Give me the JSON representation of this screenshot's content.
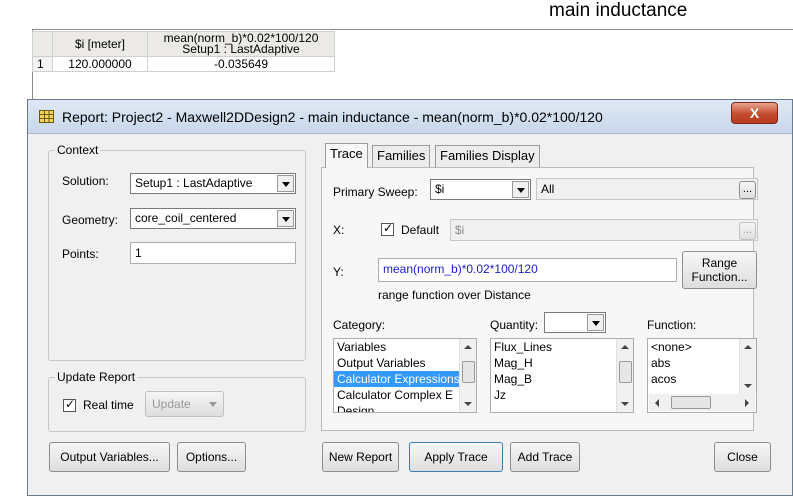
{
  "background": {
    "title": "main inductance",
    "table": {
      "headers": [
        "$i [meter]",
        "mean(norm_b)*0.02*100/120",
        "Setup1 : LastAdaptive"
      ],
      "rows": [
        [
          "1",
          "120.000000",
          "-0.035649"
        ]
      ]
    }
  },
  "dialog": {
    "title": "Report: Project2 - Maxwell2DDesign2 - main inductance - mean(norm_b)*0.02*100/120",
    "close_label": "X",
    "context": {
      "legend": "Context",
      "solution_label": "Solution:",
      "solution_value": "Setup1 : LastAdaptive",
      "geometry_label": "Geometry:",
      "geometry_value": "core_coil_centered",
      "points_label": "Points:",
      "points_value": "1"
    },
    "update": {
      "legend": "Update Report",
      "realtime_label": "Real time",
      "update_button": "Update"
    },
    "tabs": [
      "Trace",
      "Families",
      "Families Display"
    ],
    "trace": {
      "primary_sweep_label": "Primary Sweep:",
      "primary_sweep_value": "$i",
      "sweep_range": "All",
      "browse_label": "...",
      "x_label": "X:",
      "default_label": "Default",
      "x_value": "$i",
      "y_label": "Y:",
      "y_value": "mean(norm_b)*0.02*100/120",
      "range_function_button": "Range\nFunction...",
      "range_note": "range function over Distance",
      "category_label": "Category:",
      "category_items": [
        "Variables",
        "Output Variables",
        "Calculator Expressions",
        "Calculator Complex E",
        "Design"
      ],
      "category_selected": "Calculator Expressions",
      "quantity_label": "Quantity:",
      "quantity_items": [
        "Flux_Lines",
        "Mag_H",
        "Mag_B",
        "Jz"
      ],
      "function_label": "Function:",
      "function_items": [
        "<none>",
        "abs",
        "acos"
      ]
    },
    "buttons": {
      "output_variables": "Output Variables...",
      "options": "Options...",
      "new_report": "New Report",
      "apply_trace": "Apply Trace",
      "add_trace": "Add Trace",
      "close": "Close"
    }
  },
  "colors": {
    "selection": "#3399ff",
    "y_text": "#1a1acc",
    "close_button": "#c44c2e"
  }
}
